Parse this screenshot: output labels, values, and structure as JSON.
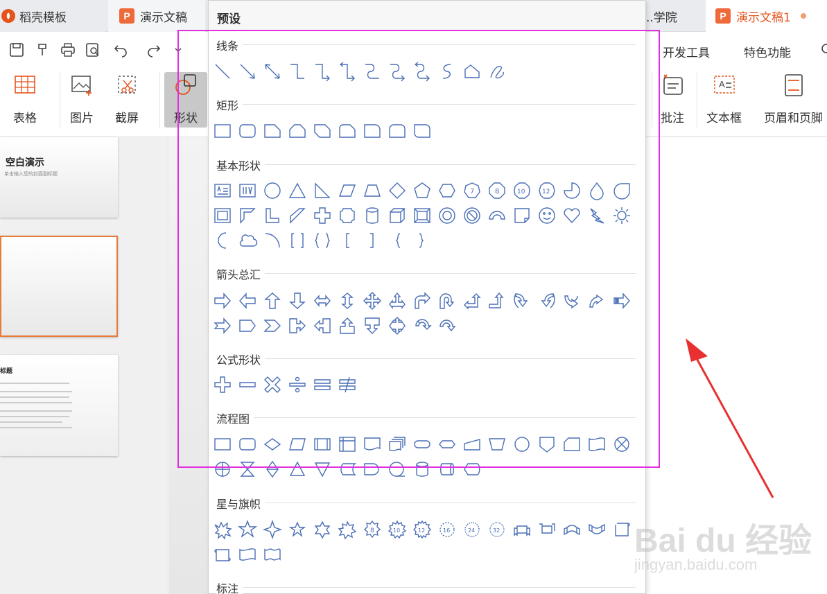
{
  "tabs": [
    {
      "label": "稻壳模板"
    },
    {
      "label": "演示文稿"
    },
    {
      "label": "..学院"
    },
    {
      "label": "演示文稿1"
    }
  ],
  "ribbon": {
    "table": "表格",
    "picture": "图片",
    "screenshot": "截屏",
    "shape": "形状",
    "comment": "批注",
    "textbox": "文本框",
    "headerfooter": "页眉和页脚"
  },
  "menu_right": {
    "dev_tools": "开发工具",
    "special": "特色功能"
  },
  "slides": {
    "s1_title": "空白演示",
    "s1_sub": "单击输入您的封面副标题",
    "s3_title": "标题"
  },
  "dropdown": {
    "title": "预设",
    "sections": {
      "lines": "线条",
      "rect": "矩形",
      "basic": "基本形状",
      "arrows": "箭头总汇",
      "formula": "公式形状",
      "flow": "流程图",
      "stars": "星与旗帜",
      "callout": "标注"
    }
  },
  "watermark": {
    "text": "Bai du 经验",
    "sub": "jingyan.baidu.com"
  },
  "colors": {
    "accent": "#e4541c",
    "shape_stroke": "#4a6fb5",
    "highlight_box": "#e030e0",
    "arrow": "#e83030"
  }
}
